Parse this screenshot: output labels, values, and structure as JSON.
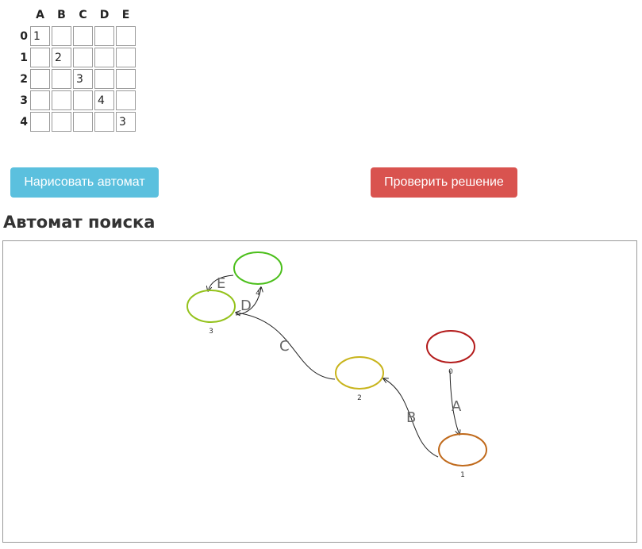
{
  "table": {
    "columns": [
      "A",
      "B",
      "C",
      "D",
      "E"
    ],
    "rows": [
      {
        "label": "0",
        "cells": [
          "1",
          "",
          "",
          "",
          ""
        ]
      },
      {
        "label": "1",
        "cells": [
          "",
          "2",
          "",
          "",
          ""
        ]
      },
      {
        "label": "2",
        "cells": [
          "",
          "",
          "3",
          "",
          ""
        ]
      },
      {
        "label": "3",
        "cells": [
          "",
          "",
          "",
          "4",
          ""
        ]
      },
      {
        "label": "4",
        "cells": [
          "",
          "",
          "",
          "",
          "3"
        ]
      }
    ]
  },
  "buttons": {
    "draw_label": "Нарисовать автомат",
    "check_label": "Проверить решение",
    "draw_color": "#5bc0de",
    "check_color": "#d9534f"
  },
  "section": {
    "title": "Автомат поиска"
  },
  "automaton": {
    "states": [
      {
        "id": "0",
        "color": "#b31b1b"
      },
      {
        "id": "1",
        "color": "#c06a1c"
      },
      {
        "id": "2",
        "color": "#c8b41c"
      },
      {
        "id": "3",
        "color": "#94c21c"
      },
      {
        "id": "4",
        "color": "#4cbf1c"
      }
    ],
    "transitions": [
      {
        "from": "0",
        "to": "1",
        "label": "A"
      },
      {
        "from": "1",
        "to": "2",
        "label": "B"
      },
      {
        "from": "2",
        "to": "3",
        "label": "C"
      },
      {
        "from": "3",
        "to": "4",
        "label": "D"
      },
      {
        "from": "4",
        "to": "3",
        "label": "E"
      }
    ]
  }
}
